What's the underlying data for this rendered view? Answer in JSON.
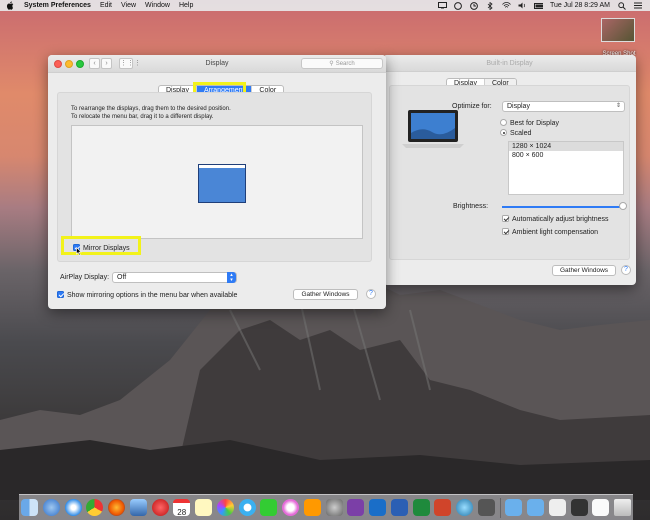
{
  "menubar": {
    "app_name": "System Preferences",
    "menus": [
      "Edit",
      "View",
      "Window",
      "Help"
    ],
    "clock": "Tue Jul 28  8:29 AM"
  },
  "desktop": {
    "screenshot_label": "Screen Shot"
  },
  "display_window": {
    "title": "Display",
    "search_placeholder": "Search",
    "tabs": [
      "Display",
      "Arrangement",
      "Color"
    ],
    "selected_tab": "Arrangement",
    "instruction_line1": "To rearrange the displays, drag them to the desired position.",
    "instruction_line2": "To relocate the menu bar, drag it to a different display.",
    "mirror_label": "Mirror Displays",
    "mirror_checked": true,
    "airplay_label": "AirPlay Display:",
    "airplay_value": "Off",
    "show_mirroring_label": "Show mirroring options in the menu bar when available",
    "gather_label": "Gather Windows",
    "help": "?"
  },
  "builtin_window": {
    "title": "Built-in Display",
    "tabs": [
      "Display",
      "Color"
    ],
    "optimize_label": "Optimize for:",
    "optimize_value": "Display",
    "best_label": "Best for Display",
    "scaled_label": "Scaled",
    "resolutions": [
      "1280 × 1024",
      "800 × 600"
    ],
    "brightness_label": "Brightness:",
    "brightness_level": 0.97,
    "auto_brightness_label": "Automatically adjust brightness",
    "ambient_label": "Ambient light compensation",
    "gather_label": "Gather Windows",
    "help": "?"
  },
  "colors": {
    "accent": "#2f7bf5",
    "highlight": "#f2f21a",
    "display_block": "#4a86d6"
  },
  "dock": {
    "apps": [
      "finder-icon",
      "launchpad-icon",
      "safari-icon",
      "chrome-icon",
      "firefox-icon",
      "preview-icon",
      "photo-booth-icon",
      "calendar-icon",
      "notes-icon",
      "photos-icon",
      "messages-icon",
      "facetime-icon",
      "itunes-icon",
      "ibooks-icon",
      "system-preferences-icon",
      "onenote-icon",
      "outlook-icon",
      "word-icon",
      "excel-icon",
      "powerpoint-icon",
      "vpn-icon",
      "network-utility-icon"
    ],
    "calendar_day": "28"
  }
}
